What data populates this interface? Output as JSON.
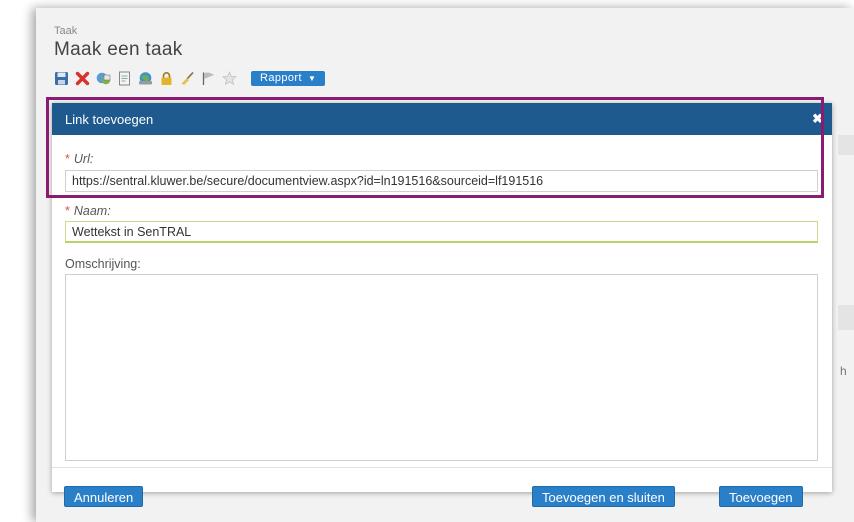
{
  "page": {
    "breadcrumb": "Taak",
    "title": "Maak een taak",
    "toolbar": {
      "icons": [
        "save-icon",
        "delete-icon",
        "copy-icon",
        "document-icon",
        "globe-link-icon",
        "lock-icon",
        "broom-icon",
        "flag-icon",
        "star-icon"
      ],
      "report_label": "Rapport",
      "report_caret": "▼"
    },
    "bg_partial_text": "h"
  },
  "modal": {
    "title": "Link toevoegen",
    "close_glyph": "✖",
    "url": {
      "required_mark": "*",
      "label": "Url:",
      "value": "https://sentral.kluwer.be/secure/documentview.aspx?id=ln191516&sourceid=lf191516"
    },
    "name": {
      "required_mark": "*",
      "label": "Naam:",
      "value": "Wettekst in SenTRAL"
    },
    "description": {
      "label": "Omschrijving:",
      "value": ""
    },
    "buttons": {
      "cancel": "Annuleren",
      "add_and_close": "Toevoegen en sluiten",
      "add": "Toevoegen"
    }
  },
  "colors": {
    "header": "#1f5a8e",
    "button": "#2a7fc9",
    "highlight": "#8b1a72",
    "required": "#d9534f"
  }
}
